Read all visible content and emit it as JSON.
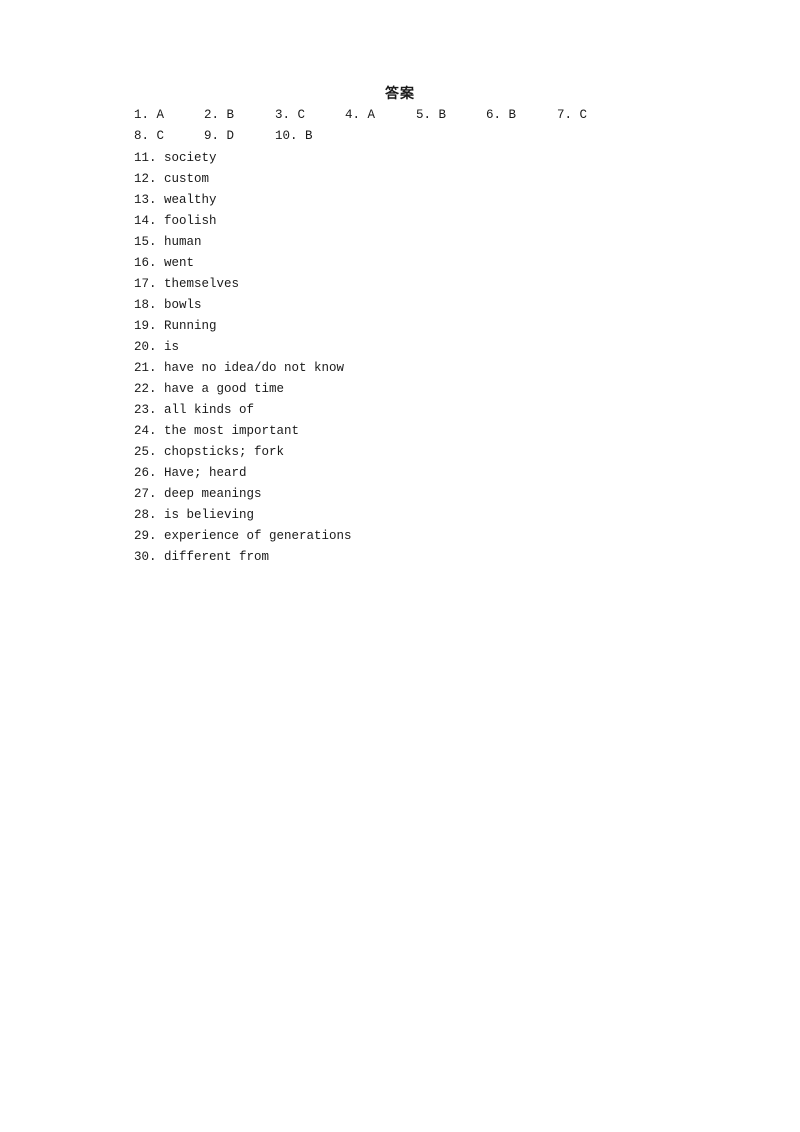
{
  "document": {
    "title": "答案",
    "multiple_choice": [
      [
        {
          "num": "1.",
          "answer": "A"
        },
        {
          "num": "2.",
          "answer": "B"
        },
        {
          "num": "3.",
          "answer": "C"
        },
        {
          "num": "4.",
          "answer": "A"
        },
        {
          "num": "5.",
          "answer": "B"
        },
        {
          "num": "6.",
          "answer": "B"
        },
        {
          "num": "7.",
          "answer": "C"
        }
      ],
      [
        {
          "num": "8.",
          "answer": "C"
        },
        {
          "num": "9.",
          "answer": "D"
        },
        {
          "num": "10.",
          "answer": "B"
        }
      ]
    ],
    "answers": [
      {
        "num": "11.",
        "text": "society"
      },
      {
        "num": "12.",
        "text": "custom"
      },
      {
        "num": "13.",
        "text": "wealthy"
      },
      {
        "num": "14.",
        "text": "foolish"
      },
      {
        "num": "15.",
        "text": "human"
      },
      {
        "num": "16.",
        "text": "went"
      },
      {
        "num": "17.",
        "text": "themselves"
      },
      {
        "num": "18.",
        "text": "bowls"
      },
      {
        "num": "19.",
        "text": "Running"
      },
      {
        "num": "20.",
        "text": "is"
      },
      {
        "num": "21.",
        "text": "have no idea/do not know"
      },
      {
        "num": "22.",
        "text": "have a good time"
      },
      {
        "num": "23.",
        "text": "all kinds of"
      },
      {
        "num": "24.",
        "text": "the most important"
      },
      {
        "num": "25.",
        "text": "chopsticks; fork"
      },
      {
        "num": "26.",
        "text": "Have; heard"
      },
      {
        "num": "27.",
        "text": "deep meanings"
      },
      {
        "num": "28.",
        "text": "is believing"
      },
      {
        "num": "29.",
        "text": "experience of generations"
      },
      {
        "num": "30.",
        "text": "different from"
      }
    ]
  }
}
